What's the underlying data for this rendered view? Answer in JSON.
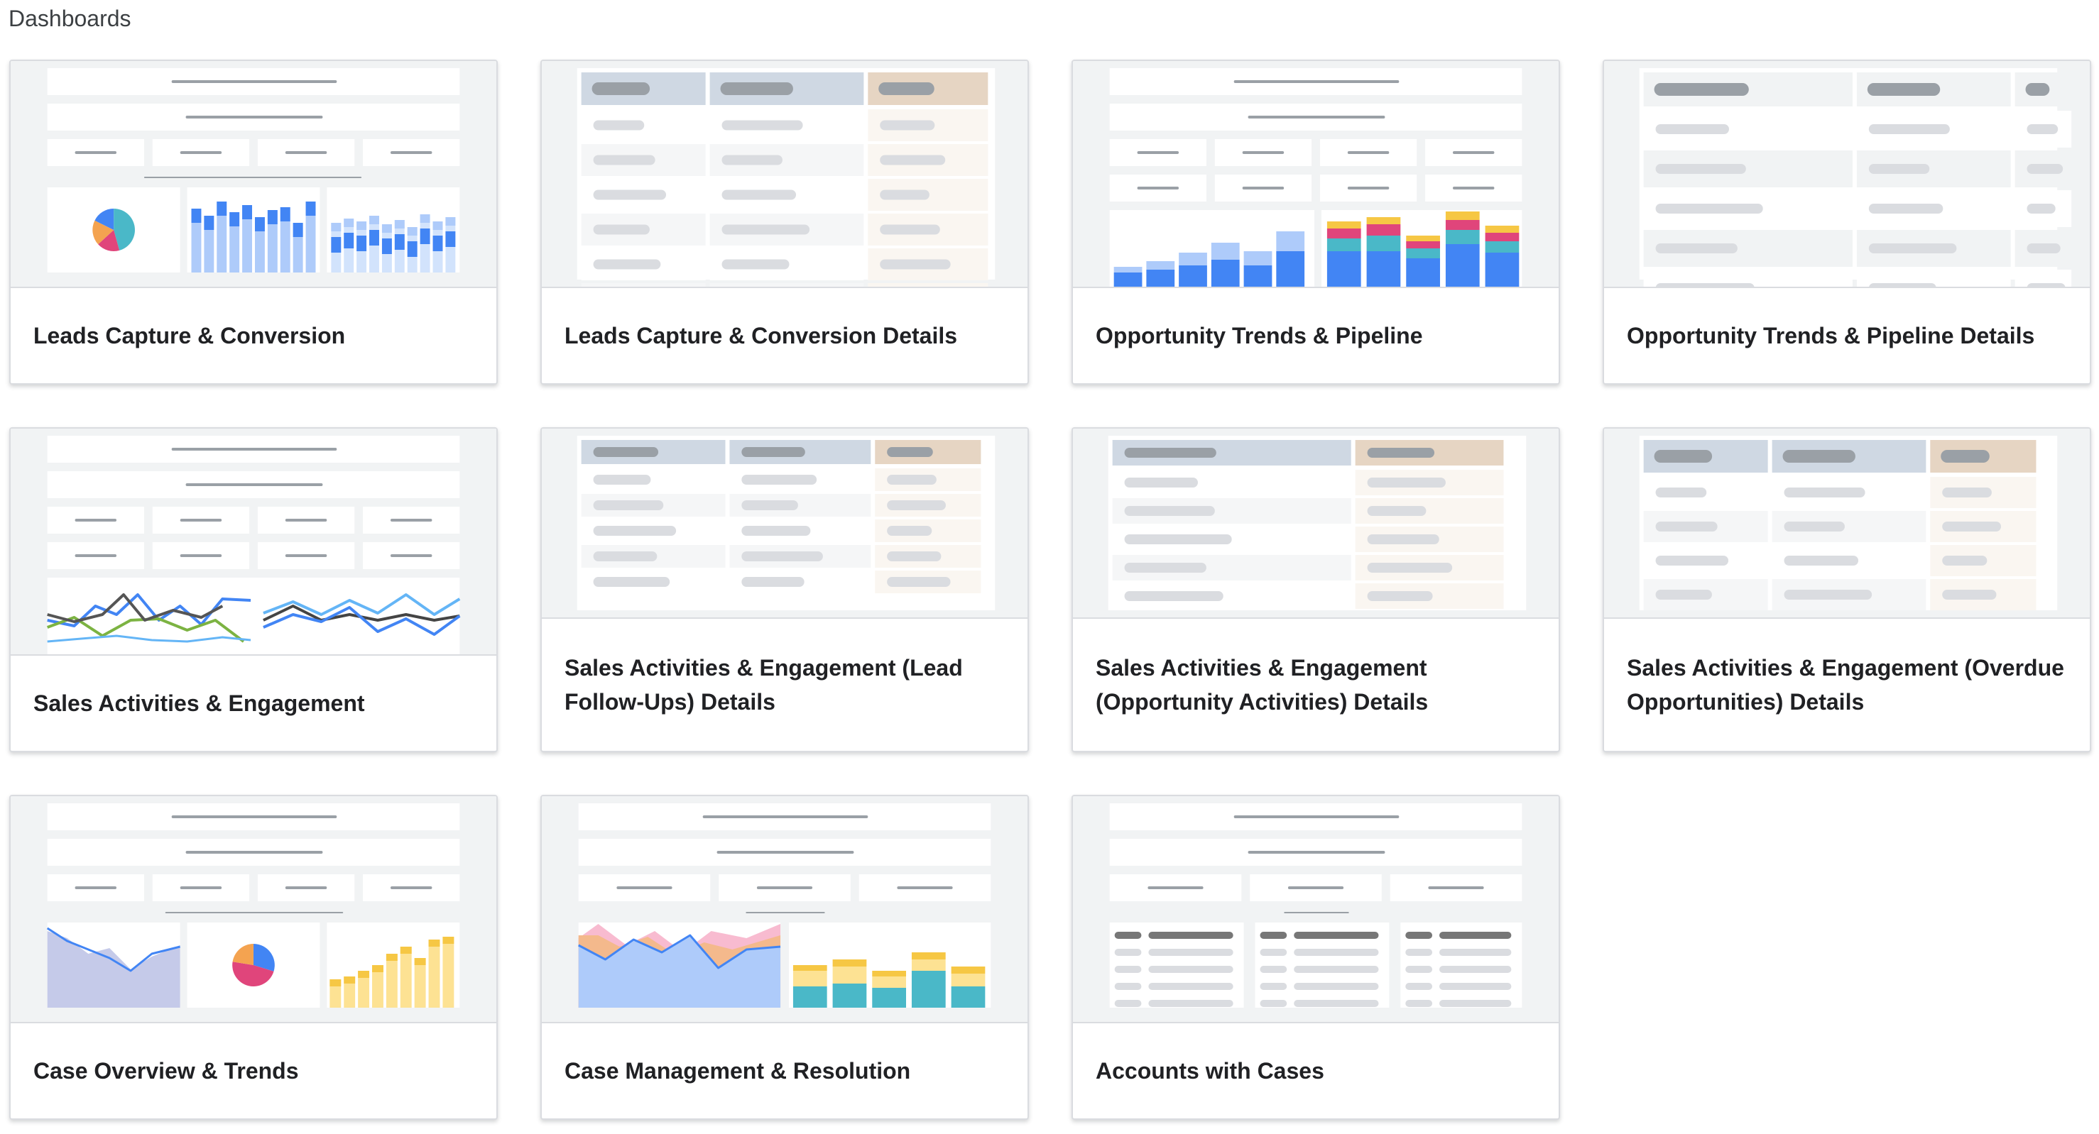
{
  "page": {
    "title": "Dashboards"
  },
  "dashboards": [
    {
      "title": "Leads Capture & Conversion",
      "preview": "report-bars"
    },
    {
      "title": "Leads Capture & Conversion Details",
      "preview": "table"
    },
    {
      "title": "Opportunity Trends & Pipeline",
      "preview": "report-stacked-bars"
    },
    {
      "title": "Opportunity Trends & Pipeline Details",
      "preview": "table-gray"
    },
    {
      "title": "Sales Activities & Engagement",
      "preview": "report-lines"
    },
    {
      "title": "Sales Activities & Engagement (Lead Follow-Ups) Details",
      "preview": "table-small"
    },
    {
      "title": "Sales Activities & Engagement (Opportunity Activities) Details",
      "preview": "table-small-2col"
    },
    {
      "title": "Sales Activities & Engagement (Overdue Opportunities) Details",
      "preview": "table"
    },
    {
      "title": "Case Overview & Trends",
      "preview": "report-area-pie-yellow"
    },
    {
      "title": "Case Management & Resolution",
      "preview": "report-area-stacked"
    },
    {
      "title": "Accounts with Cases",
      "preview": "report-tables"
    }
  ],
  "colors": {
    "blue": "#4285f4",
    "lightBlue": "#aecbfa",
    "teal": "#4ab8c8",
    "pink": "#e0457b",
    "orange": "#f4a350",
    "yellow": "#fde293",
    "gold": "#f6c744",
    "gray": "#9aa0a6"
  }
}
